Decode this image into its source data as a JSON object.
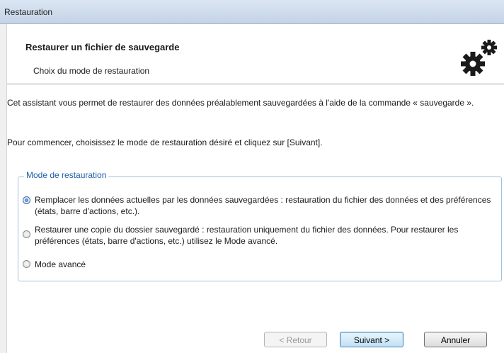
{
  "window": {
    "title": "Restauration"
  },
  "header": {
    "title": "Restaurer un fichier de sauvegarde",
    "subtitle": "Choix du mode de restauration",
    "icon": "gears-icon"
  },
  "content": {
    "intro": "Cet assistant vous permet de restaurer des données préalablement sauvegardées à l'aide de la commande « sauvegarde ».",
    "start": "Pour commencer, choisissez le mode de restauration désiré et cliquez sur [Suivant].",
    "group_title": "Mode de restauration",
    "options": [
      {
        "label": "Remplacer les données actuelles par les données sauvegardées : restauration du fichier des données et des préférences (états, barre d'actions, etc.).",
        "checked": true
      },
      {
        "label": "Restaurer une copie du dossier sauvegardé : restauration uniquement du fichier des données. Pour restaurer les préférences (états, barre d'actions, etc.) utilisez le Mode avancé.",
        "checked": false
      },
      {
        "label": "Mode avancé",
        "checked": false
      }
    ]
  },
  "buttons": {
    "back": "< Retour",
    "next": "Suivant >",
    "cancel": "Annuler"
  },
  "colors": {
    "group_title": "#1d5fa7",
    "group_border": "#9ec3de",
    "titlebar": "#c4d3e6"
  }
}
